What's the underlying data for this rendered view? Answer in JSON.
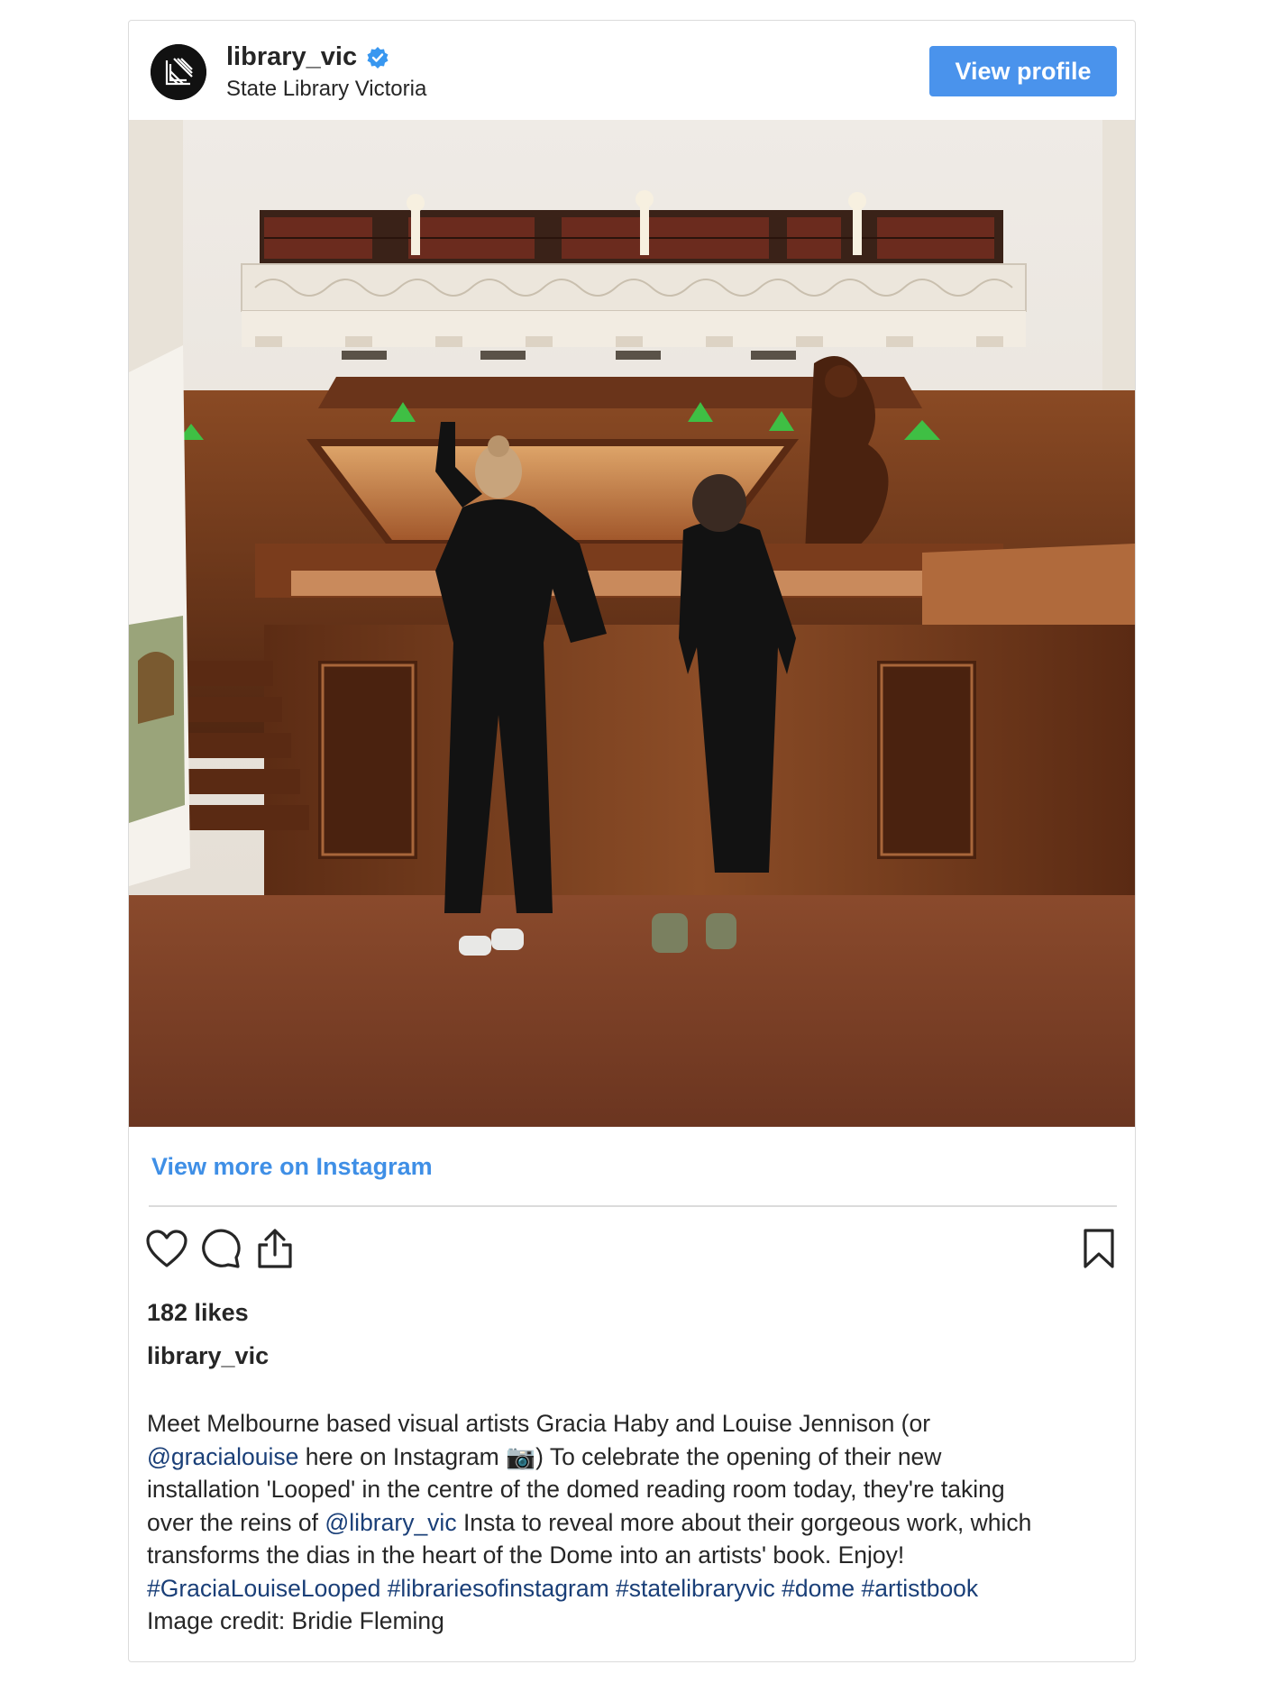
{
  "header": {
    "username": "library_vic",
    "subtitle": "State Library Victoria",
    "view_profile_label": "View profile",
    "verified_icon": "verified-badge-icon",
    "verified_color": "#3897f0",
    "avatar_icon": "state-library-victoria-logo"
  },
  "post": {
    "image_description": "",
    "view_more_label": "View more on Instagram",
    "likes": "182 likes",
    "caption_user": "library_vic",
    "caption": {
      "line1": "Meet Melbourne based visual artists Gracia Haby and Louise Jennison (or",
      "mention1": "@gracialouise",
      "line2_a": " here on Instagram ",
      "camera_emoji": "📷",
      "line2_b": ") To celebrate the opening of their new",
      "line3": "installation 'Looped' in the centre of the domed reading room today, they're taking",
      "line4_a": "over the reins of ",
      "mention2": "@library_vic",
      "line4_b": " Insta to reveal more about their gorgeous work, which",
      "line5": "transforms the dias in the heart of the Dome into an artists' book. Enjoy!",
      "hashtag1": "#GraciaLouiseLooped",
      "hashtag2": "#librariesofinstagram",
      "hashtag3": "#statelibraryvic",
      "hashtag4": "#dome",
      "hashtag5": "#artistbook",
      "credit": "Image credit: Bridie Fleming"
    }
  },
  "actions": {
    "like_icon": "heart-icon",
    "comment_icon": "comment-icon",
    "share_icon": "share-icon",
    "save_icon": "bookmark-icon"
  },
  "colors": {
    "button_blue": "#4a93ec",
    "link_blue": "#3f8fe6",
    "mention_blue": "#1a3f78",
    "border": "#dbdbdb"
  }
}
